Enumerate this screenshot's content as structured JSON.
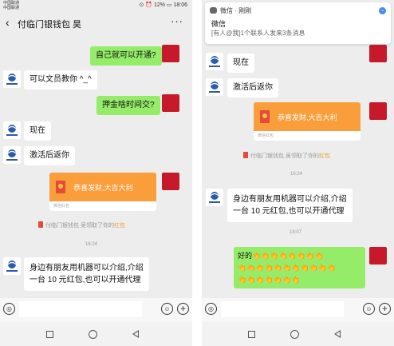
{
  "left": {
    "status": {
      "carrier1": "中国联通",
      "carrier2": "中国联通",
      "right": "⊙ ⏰ 12% ▭ 18:06"
    },
    "header": {
      "title": "付临门银钱包 昊",
      "more": "···"
    },
    "messages": [
      {
        "text": "自己就可以开通?"
      },
      {
        "text": "可以文员教你 ^_^"
      },
      {
        "text": "押金啥时间交?"
      },
      {
        "text": "现在"
      },
      {
        "text": "激活后返你"
      },
      {
        "redpacket_text": "恭喜发财,大吉大利",
        "redpacket_footer": "微信红包"
      },
      {
        "note_pre": "付临门银钱包 吴领取了你的",
        "note_hb": "红包"
      },
      {
        "timestamp": "16:24"
      },
      {
        "line1": "身边有朋友用机器可以介绍,介绍",
        "line2": "一台 10 元红包,也可以开通代理"
      }
    ]
  },
  "right": {
    "notification": {
      "app": "微信 · 刚刚",
      "title": "微信",
      "body": "[有人@我]1个联系人发来3条消息"
    },
    "messages": [
      {
        "text": "现在"
      },
      {
        "text": "激活后返你"
      },
      {
        "redpacket_text": "恭喜发财,大吉大利",
        "redpacket_footer": "微信红包"
      },
      {
        "note_pre": "付临门银钱包 吴领取了你的",
        "note_hb": "红包"
      },
      {
        "timestamp": "16:24"
      },
      {
        "line1": "身边有朋友用机器可以介绍,介绍",
        "line2": "一台 10 元红包,也可以开通代理"
      },
      {
        "timestamp": "18:07"
      },
      {
        "text": "好的",
        "emoji": "👏👏👏👏👏👏👏👏",
        "row2": "👏👏👏👏👏👏👏👏👏👏👏",
        "row3": "👏👏👏👏👏👏👏"
      }
    ]
  },
  "input": {
    "voice": "◎",
    "emoji": "☺",
    "plus": "+"
  },
  "colors": {
    "bubble_out": "#95ec69",
    "redpacket": "#fa9d3b",
    "note_hb": "#e8a02d"
  }
}
